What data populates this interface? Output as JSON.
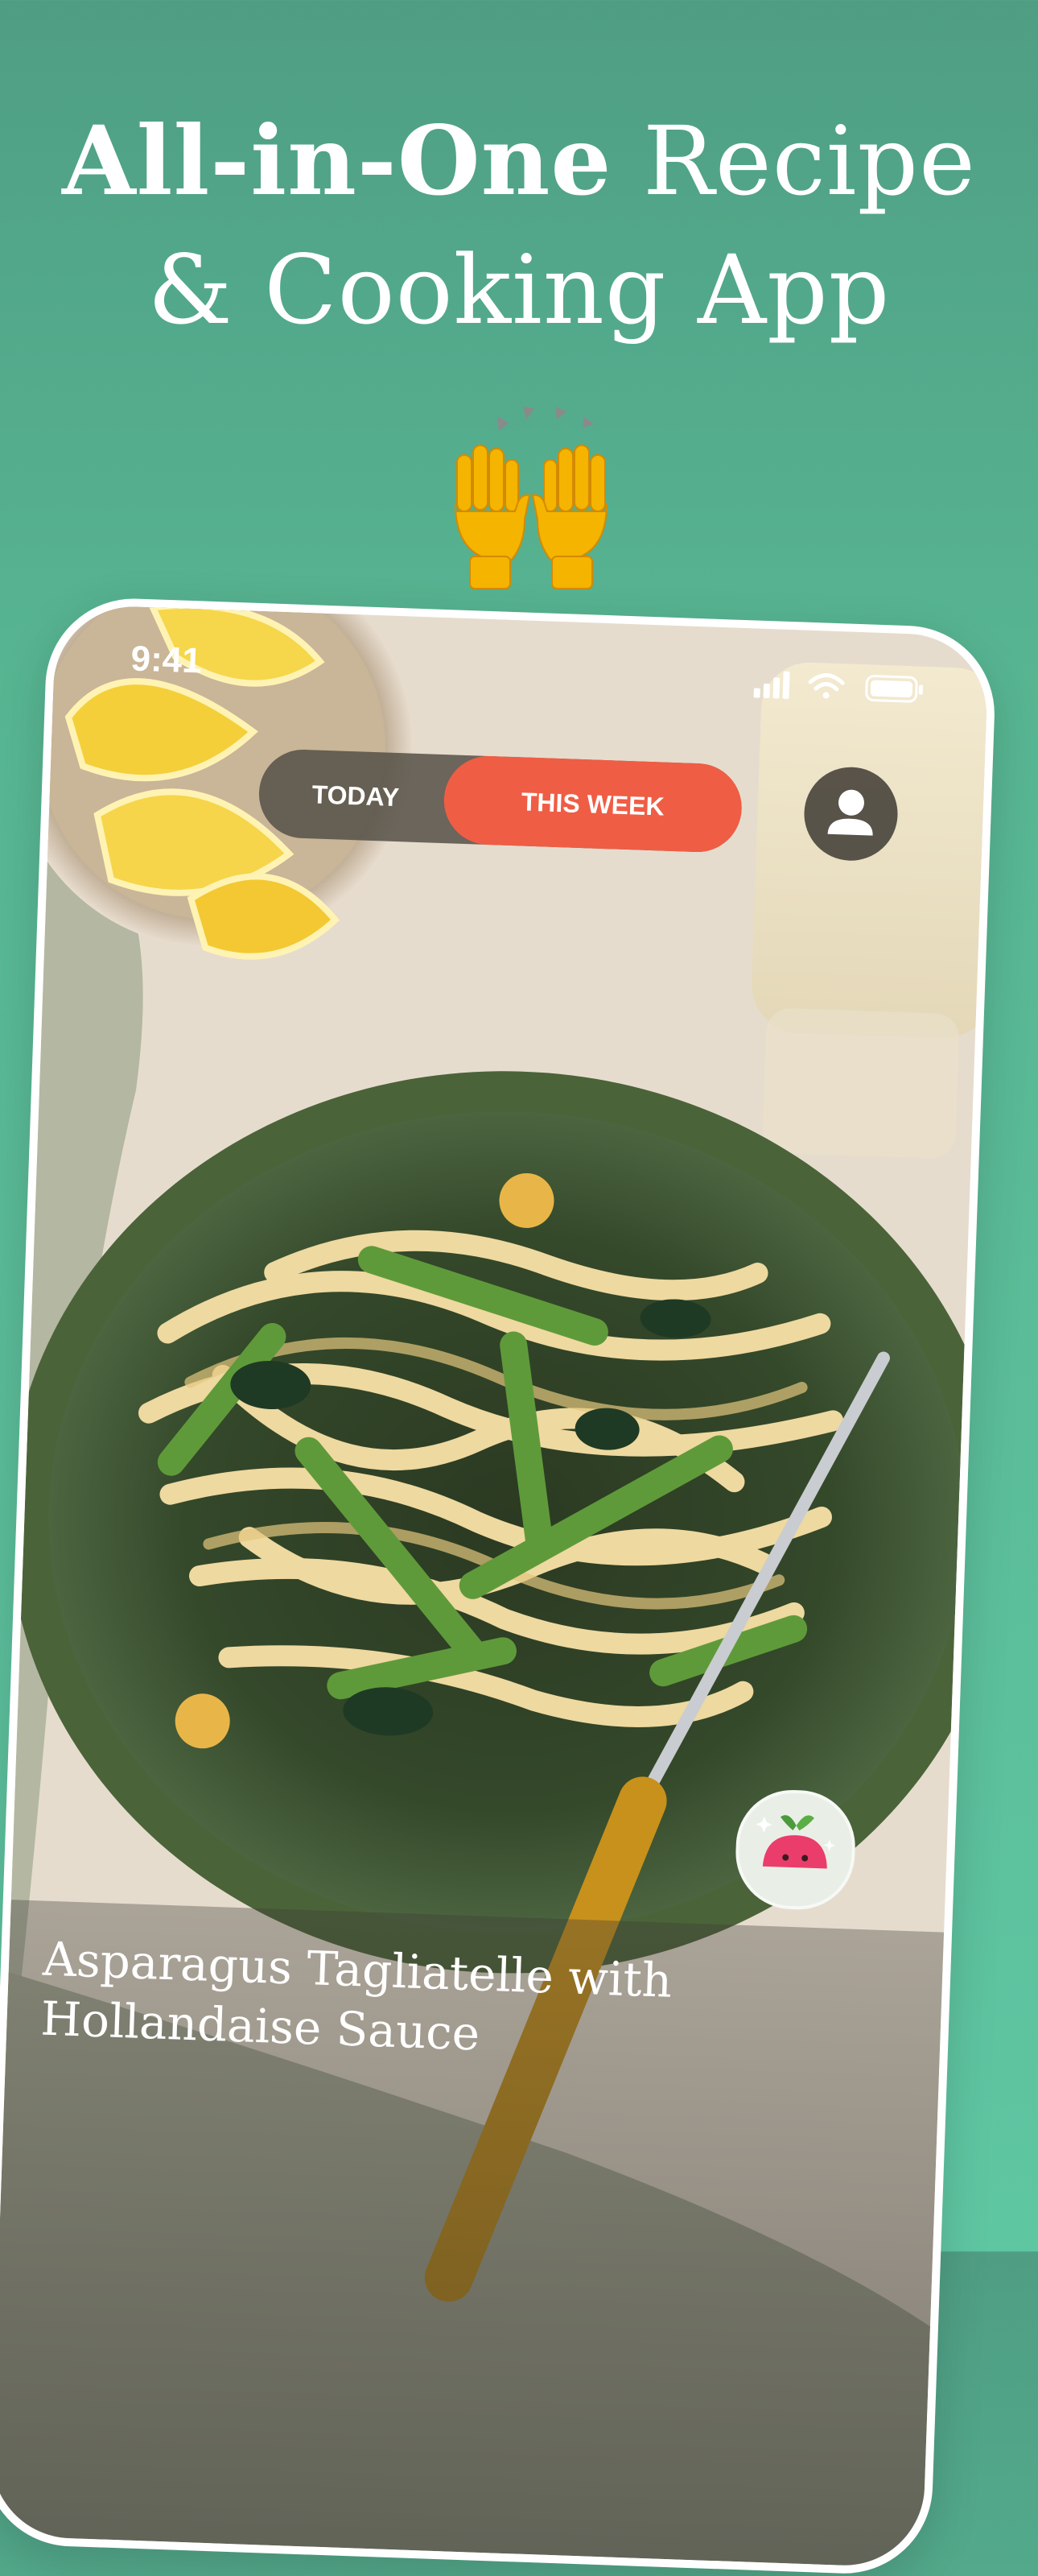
{
  "headline": {
    "bold": "All-in-One",
    "rest_line1": " Recipe",
    "line2": "& Cooking App"
  },
  "phone": {
    "status": {
      "time": "9:41"
    },
    "segmented": {
      "today_label": "TODAY",
      "week_label": "THIS WEEK",
      "selected": "THIS WEEK"
    },
    "recipe": {
      "title": "Asparagus Tagliatelle with Hollandaise Sauce"
    }
  },
  "colors": {
    "background": "#5cbf9b",
    "accent": "#ef5d45",
    "segment_bg": "#5a554c"
  },
  "icons": [
    "raising-hands-icon",
    "person-icon",
    "radish-mascot-icon",
    "signal-icon",
    "wifi-icon",
    "battery-icon"
  ]
}
